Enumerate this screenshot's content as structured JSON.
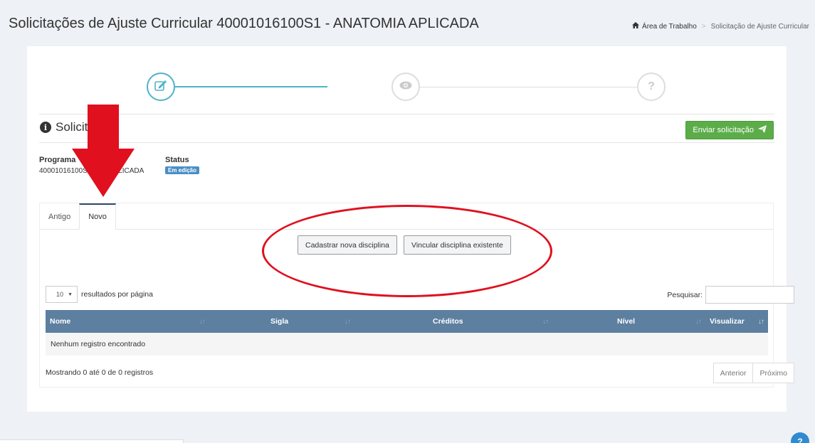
{
  "page": {
    "title": "Solicitações de Ajuste Curricular 40001016100S1 - ANATOMIA APLICADA"
  },
  "breadcrumb": {
    "home": "Área de Trabalho",
    "separator": ">",
    "current": "Solicitação de Ajuste Curricular"
  },
  "wizard": {
    "steps": [
      {
        "icon": "edit-icon",
        "state": "active"
      },
      {
        "icon": "eye-icon",
        "state": "pending"
      },
      {
        "icon": "question-icon",
        "symbol": "?",
        "state": "pending"
      }
    ]
  },
  "section": {
    "title": "Solicit",
    "send_button": "Enviar solicitação"
  },
  "info": {
    "program_label": "Programa",
    "program_value": "40001016100S        OMIA APLICADA",
    "status_label": "Status",
    "status_value": "Em edição"
  },
  "tabs": [
    {
      "label": "Antigo",
      "active": false
    },
    {
      "label": "Novo",
      "active": true
    }
  ],
  "actions": {
    "new_discipline": "Cadastrar nova disciplina",
    "link_discipline": "Vincular disciplina existente"
  },
  "table_controls": {
    "page_size": "10",
    "page_size_label": "resultados por página",
    "search_label": "Pesquisar:",
    "search_value": ""
  },
  "table": {
    "columns": [
      "Nome",
      "Sigla",
      "Créditos",
      "Nível",
      "Visualizar"
    ],
    "empty_message": "Nenhum registro encontrado"
  },
  "footer": {
    "info": "Mostrando 0 até 0 de 0 registros",
    "prev": "Anterior",
    "next": "Próximo"
  },
  "help": {
    "symbol": "?"
  },
  "colors": {
    "accent": "#4fb3c8",
    "send_button": "#5cad4a",
    "table_header": "#5d7fa0",
    "annotation": "#e0101e"
  }
}
